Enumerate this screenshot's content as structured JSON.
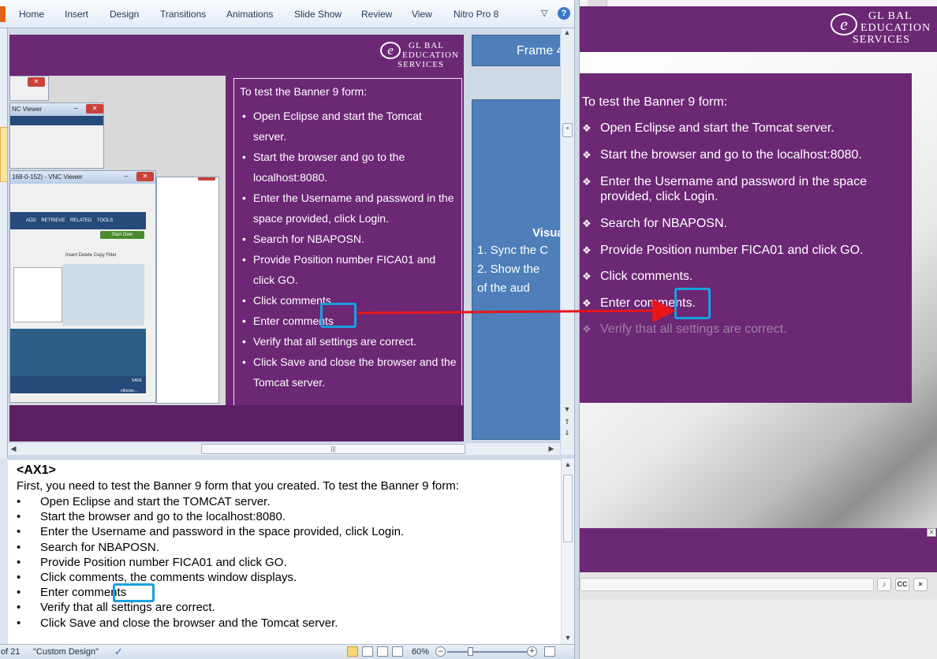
{
  "ribbon": {
    "tabs": [
      "Home",
      "Insert",
      "Design",
      "Transitions",
      "Animations",
      "Slide Show",
      "Review",
      "View",
      "Nitro Pro 8"
    ],
    "collapse_icon": "chevron-down-icon",
    "help_icon": "help-icon",
    "help_glyph": "?"
  },
  "logo": {
    "mark": "e",
    "line1": "GL BAL",
    "line2": "EDUCATION",
    "line3": "SERVICES"
  },
  "slide": {
    "intro": "To test the Banner 9 form:",
    "items": [
      "Open Eclipse and start the Tomcat server.",
      "Start the browser and go to the localhost:8080.",
      "Enter the Username and password in the space provided, click Login.",
      "Search for NBAPOSN.",
      "Provide Position number FICA01 and click GO.",
      "Click comments.",
      "Enter comments",
      "Verify that all settings are correct.",
      "Click Save and close the browser and the Tomcat server."
    ],
    "frame_label": "Frame 4",
    "visual_heading": "Visua",
    "visual_lines": [
      "1.   Sync the C",
      "2.   Show the",
      "      of the aud"
    ]
  },
  "vnc": {
    "title": "168-0-152) - VNC Viewer",
    "title2": "NC Viewer",
    "nav": [
      "ADD",
      "RETRIEVE",
      "RELATED",
      "TOOLS"
    ],
    "start_over": "Start Over",
    "toolbar": "Insert   Delete   Copy   Filter",
    "save": "SAVE",
    "user": "ellucian..."
  },
  "notes": {
    "title": "<AX1>",
    "first": "First, you need to test the Banner 9 form that you created.  To test the Banner 9 form:",
    "items": [
      "Open Eclipse and start the TOMCAT server.",
      "Start the browser and go to the localhost:8080.",
      "Enter the Username and password in the space provided, click Login.",
      "Search for NBAPOSN.",
      "Provide Position number FICA01 and click GO.",
      "Click comments, the comments window displays.",
      "Enter comments",
      "Verify that all settings are correct.",
      "Click Save and close the browser and the Tomcat server."
    ]
  },
  "status": {
    "slide_count": "of 21",
    "theme": "\"Custom Design\"",
    "zoom": "60%",
    "zoom_level_percent": 60
  },
  "preview": {
    "intro": "To test the Banner 9 form:",
    "items": [
      "Open Eclipse and start the Tomcat server.",
      "Start the browser and go to the localhost:8080.",
      "Enter the Username and password in the space provided, click Login.",
      "Search for NBAPOSN.",
      "Provide Position number FICA01 and click GO.",
      "Click comments.",
      "Enter comments.",
      "Verify that all settings are correct."
    ],
    "controls": [
      "volume-icon",
      "closed-captions-icon",
      "close-icon"
    ],
    "cc_label": "CC",
    "close_glyph": "×"
  },
  "colors": {
    "slide_purple": "#6c2775",
    "frame_blue": "#4e7fba",
    "highlight_blue": "#1a9fde",
    "arrow_red": "#e8151b"
  }
}
